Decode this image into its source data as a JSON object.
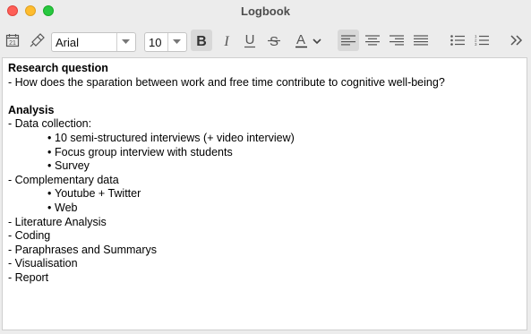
{
  "window": {
    "title": "Logbook"
  },
  "toolbar": {
    "font_family": "Arial",
    "font_size": "10",
    "buttons": [
      "calendar-icon",
      "format-painter-icon",
      "bold",
      "italic",
      "underline",
      "strikethrough",
      "text-color",
      "align-left",
      "align-center",
      "align-right",
      "justify",
      "bulleted-list",
      "numbered-list",
      "more"
    ],
    "accent": "#d8d8d8"
  },
  "doc": {
    "h1": "Research question",
    "q": "- How does the sparation between work and free time contribute to cognitive well-being?",
    "h2": "Analysis",
    "l1": "- Data collection:",
    "b1": "10 semi-structured interviews (+ video interview)",
    "b2": "Focus group interview with students",
    "b3": "Survey",
    "l2": "- Complementary data",
    "b4": "Youtube + Twitter",
    "b5": "Web",
    "l3": "- Literature Analysis",
    "l4": "- Coding",
    "l5": "- Paraphrases and Summarys",
    "l6": "- Visualisation",
    "l7": "- Report"
  }
}
